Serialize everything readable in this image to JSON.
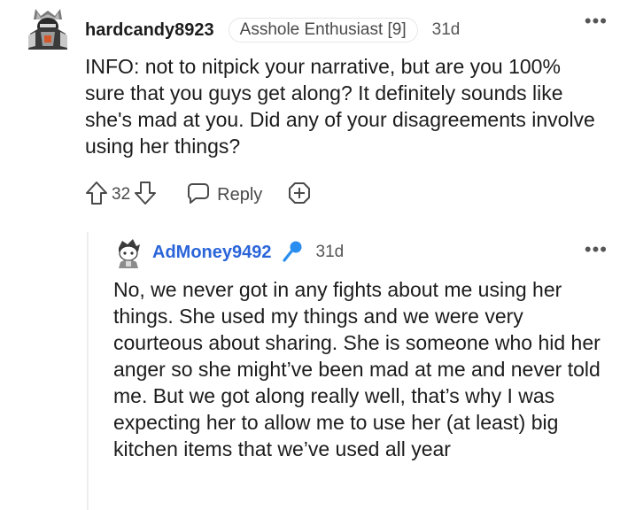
{
  "top_comment": {
    "username": "hardcandy8923",
    "flair": "Asshole Enthusiast [9]",
    "timestamp": "31d",
    "more_label": "•••",
    "body": "INFO: not to nitpick your narrative, but are you 100% sure that you guys get along? It definitely sounds like she's mad at you. Did any of your disagreements involve using her things?",
    "votes": "32",
    "reply_label": "Reply"
  },
  "reply_comment": {
    "username": "AdMoney9492",
    "timestamp": "31d",
    "more_label": "•••",
    "body": "No, we never got in any fights about me using her things. She used my things and we were very courteous about sharing. She is someone who hid her anger so she might’ve been mad at me and never told me. But we got along really well, that’s why I was expecting her to allow me to use her (at least) big kitchen items that we’ve used all year"
  },
  "icons": {
    "upvote": "upvote-arrow-icon",
    "downvote": "downvote-arrow-icon",
    "reply": "speech-bubble-icon",
    "award": "add-award-icon",
    "mic": "microphone-icon"
  },
  "colors": {
    "username_reply": "#2a65d9",
    "mic": "#2a8ef0",
    "text": "#1c1c1c"
  }
}
